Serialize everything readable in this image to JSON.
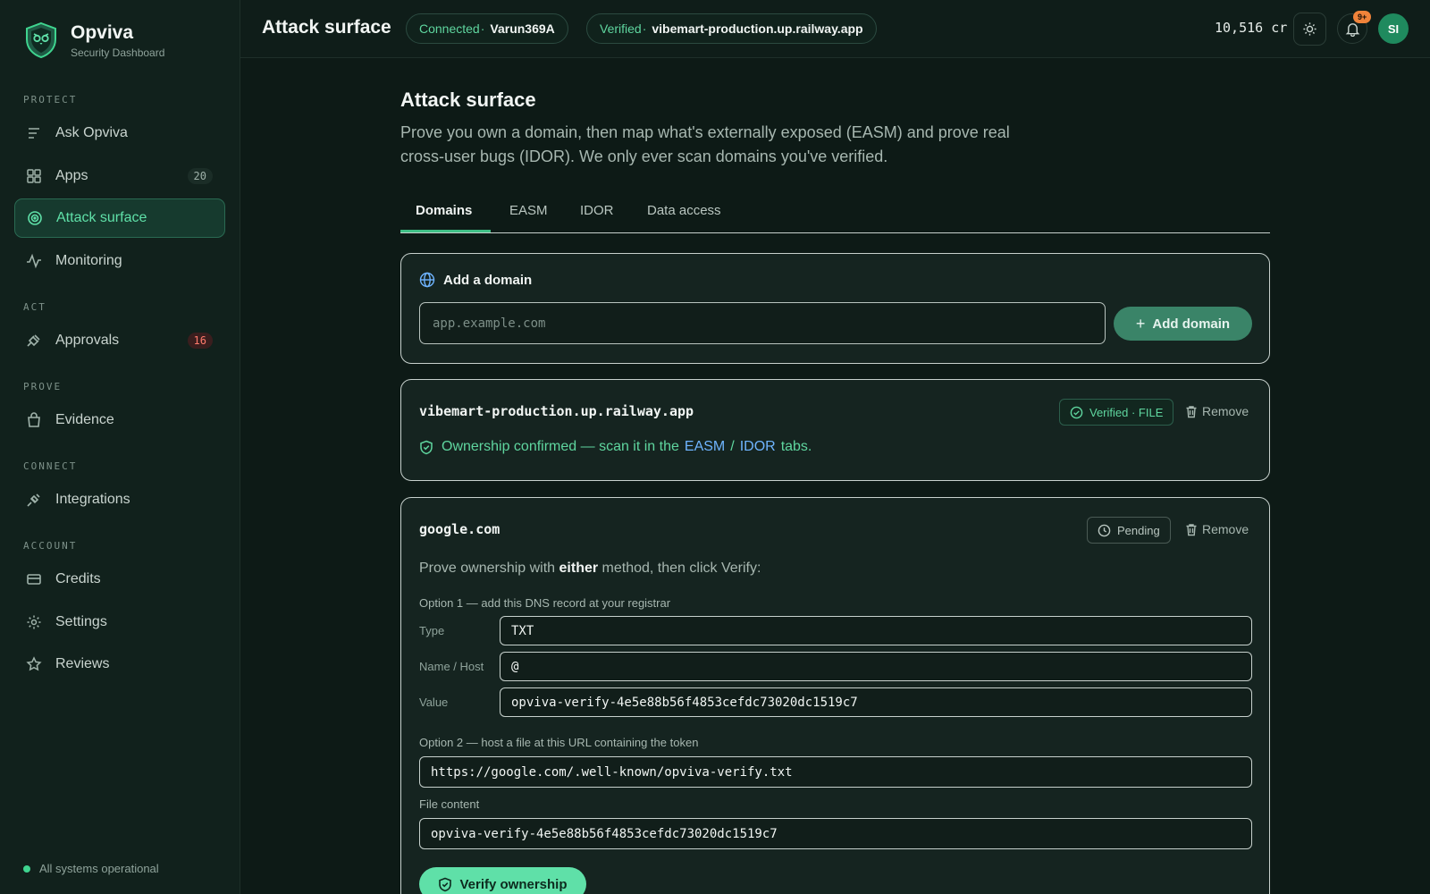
{
  "brand": {
    "name": "Opviva",
    "subtitle": "Security Dashboard"
  },
  "sidebar": {
    "sections": {
      "protect": "PROTECT",
      "act": "ACT",
      "prove": "PROVE",
      "connect": "CONNECT",
      "account": "ACCOUNT"
    },
    "items": {
      "ask": {
        "label": "Ask Opviva"
      },
      "apps": {
        "label": "Apps",
        "badge": "20"
      },
      "attack": {
        "label": "Attack surface"
      },
      "monitoring": {
        "label": "Monitoring"
      },
      "approvals": {
        "label": "Approvals",
        "badge": "16"
      },
      "evidence": {
        "label": "Evidence"
      },
      "integrations": {
        "label": "Integrations"
      },
      "credits": {
        "label": "Credits"
      },
      "settings": {
        "label": "Settings"
      },
      "reviews": {
        "label": "Reviews"
      }
    },
    "status": "All systems operational"
  },
  "header": {
    "title": "Attack surface",
    "connected": {
      "key": "Connected",
      "value": "Varun369A"
    },
    "verified": {
      "key": "Verified",
      "value": "vibemart-production.up.railway.app"
    },
    "credits": "10,516 cr",
    "notif_badge": "9+",
    "avatar": "SI"
  },
  "main": {
    "title": "Attack surface",
    "description": "Prove you own a domain, then map what's externally exposed (EASM) and prove real cross-user bugs (IDOR). We only ever scan domains you've verified.",
    "tabs": [
      "Domains",
      "EASM",
      "IDOR",
      "Data access"
    ],
    "add_domain": {
      "heading": "Add a domain",
      "placeholder": "app.example.com",
      "button": "Add domain"
    },
    "domains": [
      {
        "name": "vibemart-production.up.railway.app",
        "status": "Verified · FILE",
        "remove": "Remove",
        "ownership_text": "Ownership confirmed — scan it in the",
        "link1": "EASM",
        "slash": "/",
        "link2": "IDOR",
        "tail": "tabs."
      },
      {
        "name": "google.com",
        "status": "Pending",
        "remove": "Remove",
        "prove_pre": "Prove ownership with ",
        "prove_bold": "either",
        "prove_post": " method, then click Verify:",
        "option1": "Option 1 — add this DNS record at your registrar",
        "type_label": "Type",
        "type_value": "TXT",
        "host_label": "Name / Host",
        "host_value": "@",
        "value_label": "Value",
        "value_value": "opviva-verify-4e5e88b56f4853cefdc73020dc1519c7",
        "option2": "Option 2 — host a file at this URL containing the token",
        "url_value": "https://google.com/.well-known/opviva-verify.txt",
        "file_label": "File content",
        "file_value": "opviva-verify-4e5e88b56f4853cefdc73020dc1519c7",
        "verify_button": "Verify ownership"
      }
    ]
  },
  "colors": {
    "accent": "#5fe0a8",
    "alert": "#ff7a6b",
    "link": "#6fb4ff",
    "background": "#0d1a16"
  }
}
